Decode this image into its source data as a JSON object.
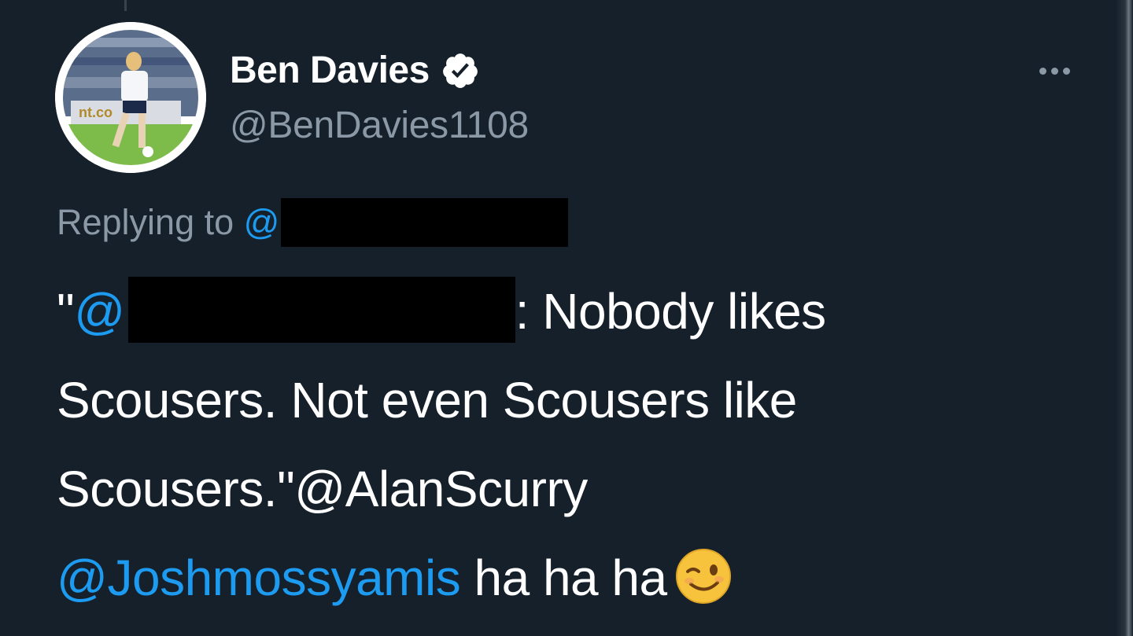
{
  "author": {
    "display_name": "Ben Davies",
    "handle": "@BenDavies1108",
    "verified": true,
    "avatar_icon": "footballer-photo"
  },
  "reply": {
    "label": "Replying to",
    "at_symbol": "@"
  },
  "tweet": {
    "quote_open": "\"",
    "at_symbol": "@",
    "line1_text": ": Nobody likes",
    "line2_text": "Scousers. Not even Scousers like",
    "line3_text": "Scousers.\"",
    "mention1": "@AlanScurry",
    "mention2": "@Joshmossyamis",
    "trailing_text": " ha ha ha",
    "emoji": "winking-face-icon"
  },
  "colors": {
    "background": "#15202b",
    "link": "#1d9bf0",
    "secondary_text": "#8b98a5",
    "verified_badge": "#ffffff"
  }
}
